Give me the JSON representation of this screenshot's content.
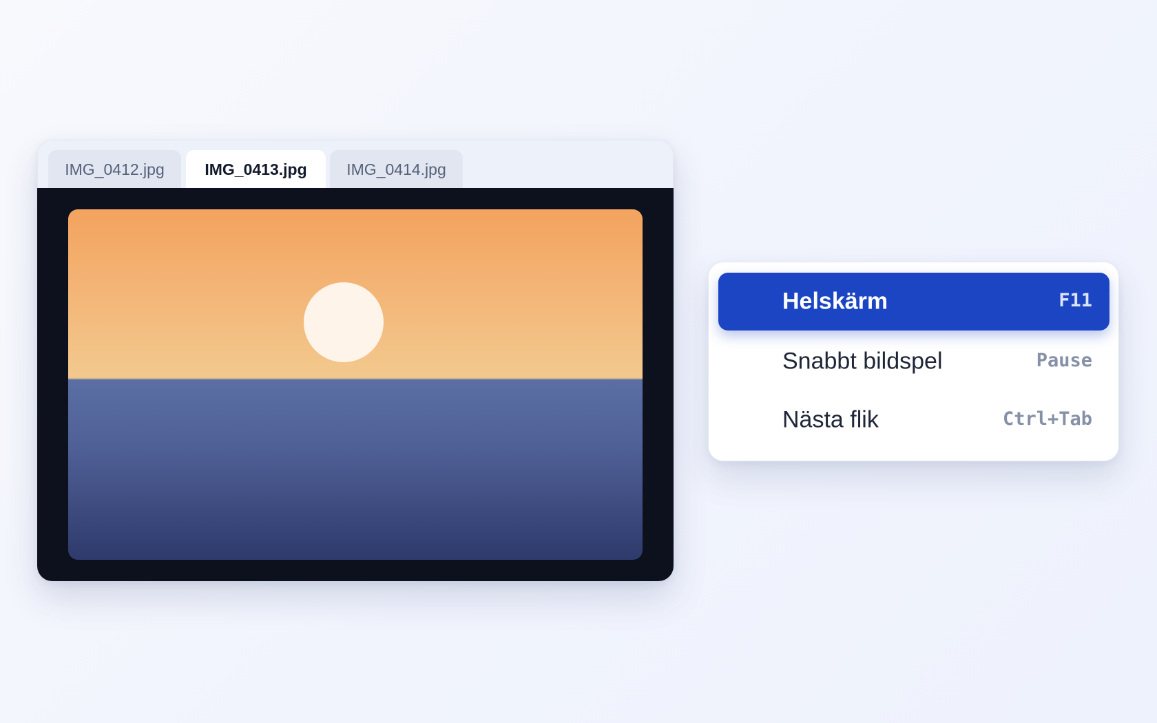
{
  "viewer": {
    "tabs": [
      {
        "label": "IMG_0412.jpg",
        "active": false
      },
      {
        "label": "IMG_0413.jpg",
        "active": true
      },
      {
        "label": "IMG_0414.jpg",
        "active": false
      }
    ]
  },
  "context_menu": {
    "items": [
      {
        "label": "Helskärm",
        "shortcut": "F11",
        "highlighted": true
      },
      {
        "label": "Snabbt bildspel",
        "shortcut": "Pause",
        "highlighted": false
      },
      {
        "label": "Nästa flik",
        "shortcut": "Ctrl+Tab",
        "highlighted": false
      }
    ]
  },
  "colors": {
    "accent": "#1c45c4",
    "stage_background": "#0d111d",
    "sky_top": "#f3a35e",
    "sky_bottom": "#f3c98e",
    "sea_top": "#5b6fa4",
    "sea_bottom": "#2e3a6b",
    "sun": "#fff4e9"
  }
}
